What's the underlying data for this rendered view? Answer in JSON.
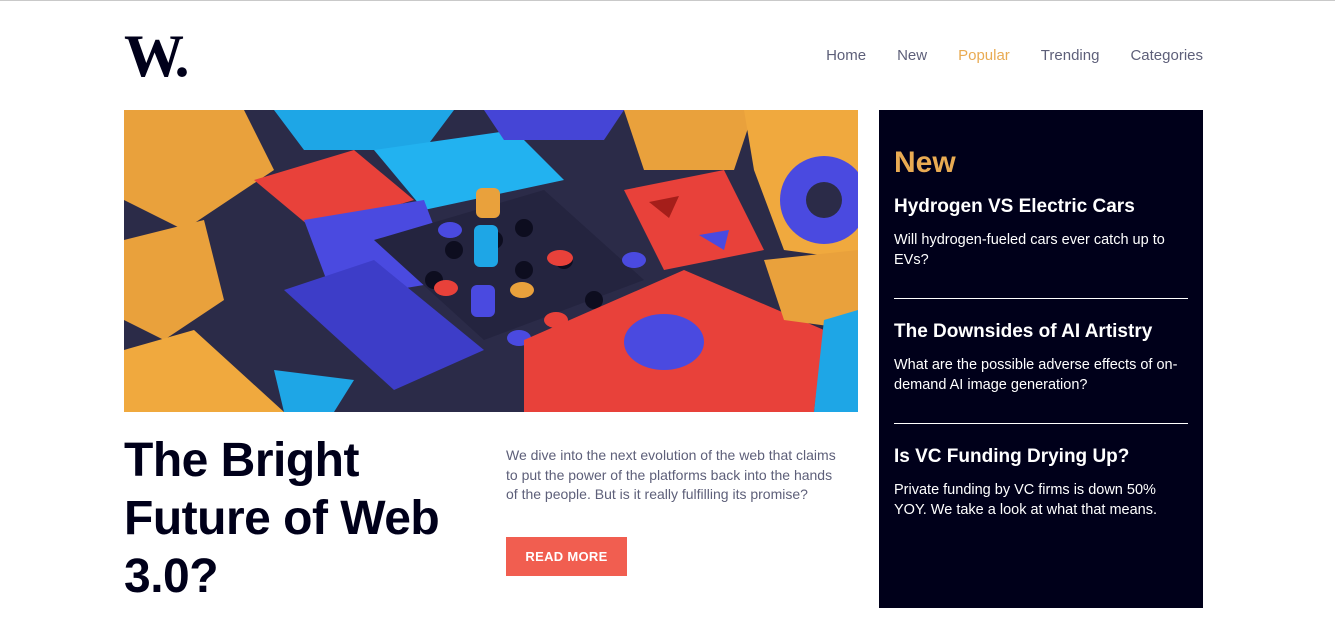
{
  "brand": {
    "logo": "W."
  },
  "nav": {
    "items": [
      {
        "label": "Home",
        "active": false
      },
      {
        "label": "New",
        "active": false
      },
      {
        "label": "Popular",
        "active": true
      },
      {
        "label": "Trending",
        "active": false
      },
      {
        "label": "Categories",
        "active": false
      }
    ]
  },
  "hero": {
    "image_alt": "abstract-colorful-blocks-illustration",
    "headline": "The Bright Future of Web 3.0?",
    "intro": "We dive into the next evolution of the web that claims to put the power of the platforms back into the hands of the people. But is it really fulfilling its promise?",
    "cta_label": "READ MORE"
  },
  "sidebar": {
    "title": "New",
    "items": [
      {
        "heading": "Hydrogen VS Electric Cars",
        "description": "Will hydrogen-fueled cars ever catch up to EVs?"
      },
      {
        "heading": "The Downsides of AI Artistry",
        "description": "What are the possible adverse effects of on-demand AI image generation?"
      },
      {
        "heading": "Is VC Funding Drying Up?",
        "description": "Private funding by VC firms is down 50% YOY. We take a look at what that means."
      }
    ]
  },
  "colors": {
    "dark_navy": "#00001a",
    "accent_orange": "#e9ab53",
    "accent_red": "#f15e50",
    "text_grey": "#5d5f79"
  }
}
